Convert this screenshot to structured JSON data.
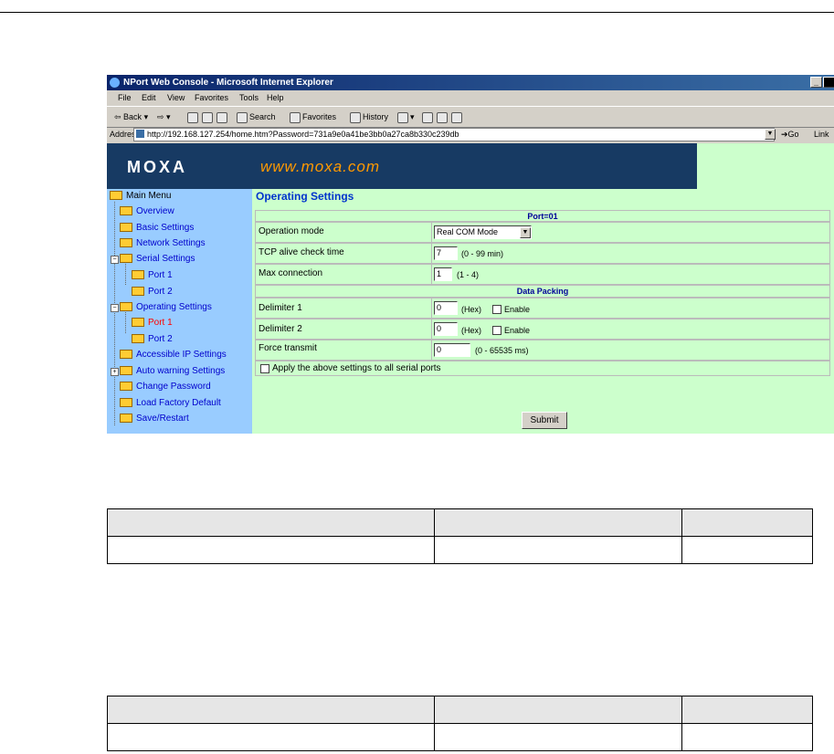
{
  "window": {
    "title": "NPort Web Console - Microsoft Internet Explorer"
  },
  "menu": [
    "File",
    "Edit",
    "View",
    "Favorites",
    "Tools",
    "Help"
  ],
  "toolbar": {
    "back": "Back",
    "search": "Search",
    "favorites": "Favorites",
    "history": "History"
  },
  "address": {
    "label": "Address",
    "url": "http://192.168.127.254/home.htm?Password=731a9e0a41be3bb0a27ca8b330c239db",
    "go": "Go",
    "links": "Link"
  },
  "banner": {
    "logo": "MOXA",
    "url": "www.moxa.com"
  },
  "sidebar": {
    "items": [
      {
        "label": "Main Menu"
      },
      {
        "label": "Overview"
      },
      {
        "label": "Basic Settings"
      },
      {
        "label": "Network Settings"
      },
      {
        "label": "Serial Settings"
      },
      {
        "label": "Port 1"
      },
      {
        "label": "Port 2"
      },
      {
        "label": "Operating Settings"
      },
      {
        "label": "Port 1"
      },
      {
        "label": "Port 2"
      },
      {
        "label": "Accessible IP Settings"
      },
      {
        "label": "Auto warning Settings"
      },
      {
        "label": "Change Password"
      },
      {
        "label": "Load Factory Default"
      },
      {
        "label": "Save/Restart"
      }
    ]
  },
  "main": {
    "title": "Operating Settings",
    "port_header": "Port=01",
    "operation_mode": {
      "label": "Operation mode",
      "value": "Real COM Mode"
    },
    "tcp_alive": {
      "label": "TCP alive check time",
      "value": "7",
      "unit": "(0 - 99 min)"
    },
    "max_connection": {
      "label": "Max connection",
      "value": "1",
      "unit": "(1 - 4)"
    },
    "packing_header": "Data Packing",
    "delimiter1": {
      "label": "Delimiter 1",
      "value": "0",
      "unit": "(Hex)",
      "enable": "Enable"
    },
    "delimiter2": {
      "label": "Delimiter 2",
      "value": "0",
      "unit": "(Hex)",
      "enable": "Enable"
    },
    "force_transmit": {
      "label": "Force transmit",
      "value": "0",
      "unit": "(0 - 65535 ms)"
    },
    "apply_all": "Apply the above settings to all serial ports",
    "submit": "Submit"
  }
}
